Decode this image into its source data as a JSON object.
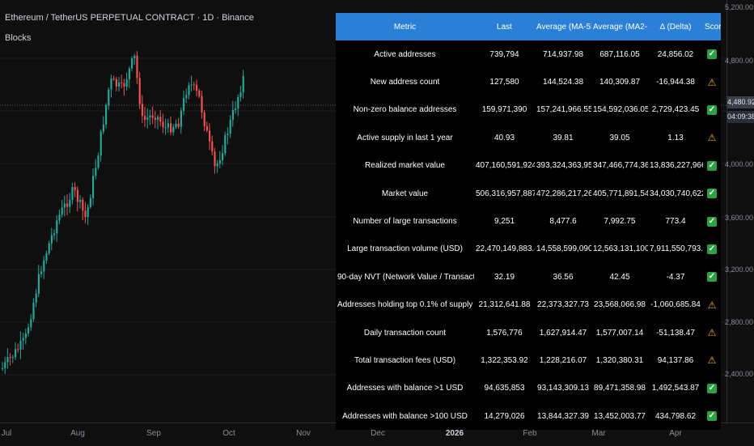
{
  "chart": {
    "title": "Ethereum / TetherUS PERPETUAL CONTRACT · 1D · Binance",
    "indicator": "Blocks",
    "price_labels": [
      "5,200.00",
      "4,800.00",
      "4,400.00",
      "4,000.00",
      "3,600.00",
      "3,200.00",
      "2,800.00",
      "2,400.00"
    ],
    "current_price": "4,480.92",
    "countdown": "04:09:38",
    "time_labels": [
      "Jul",
      "Aug",
      "Sep",
      "Oct",
      "Nov",
      "Dec",
      "2026",
      "Feb",
      "Mar",
      "Apr"
    ],
    "colors": {
      "up": "#26a69a",
      "down": "#ef5350",
      "header": "#2b7fd6"
    }
  },
  "table": {
    "headers": [
      "Metric",
      "Last",
      "Average (MA-55)",
      "Average (MA2-111)",
      "Δ (Delta)",
      "Score"
    ],
    "rows": [
      {
        "metric": "Active addresses",
        "last": "739,794",
        "ma55": "714,937.98",
        "ma111": "687,116.05",
        "delta": "24,856.02",
        "score": "✓",
        "status": "ok"
      },
      {
        "metric": "New address count",
        "last": "127,580",
        "ma55": "144,524.38",
        "ma111": "140,309.87",
        "delta": "-16,944.38",
        "score": "⚠",
        "status": "warn"
      },
      {
        "metric": "Non-zero balance addresses",
        "last": "159,971,390",
        "ma55": "157,241,966.55",
        "ma111": "154,592,036.05",
        "delta": "2,729,423.45",
        "score": "✓",
        "status": "ok"
      },
      {
        "metric": "Active supply in last 1 year",
        "last": "40.93",
        "ma55": "39.81",
        "ma111": "39.05",
        "delta": "1.13",
        "score": "⚠",
        "status": "warn"
      },
      {
        "metric": "Realized market value",
        "last": "407,160,591,924.48",
        "ma55": "393,324,363,958.23",
        "ma111": "347,466,774,365.38",
        "delta": "13,836,227,966.25",
        "score": "✓",
        "status": "ok"
      },
      {
        "metric": "Market value",
        "last": "506,316,957,887.36",
        "ma55": "472,286,217,264.83",
        "ma111": "405,771,891,549.84",
        "delta": "34,030,740,622.53",
        "score": "✓",
        "status": "ok"
      },
      {
        "metric": "Number of large transactions",
        "last": "9,251",
        "ma55": "8,477.6",
        "ma111": "7,992.75",
        "delta": "773.4",
        "score": "✓",
        "status": "ok"
      },
      {
        "metric": "Large transaction volume (USD)",
        "last": "22,470,149,883.85",
        "ma55": "14,558,599,090.63",
        "ma111": "12,563,131,100.91",
        "delta": "7,911,550,793.23",
        "score": "✓",
        "status": "ok"
      },
      {
        "metric": "90-day NVT (Network Value / Transaction Volume)",
        "last": "32.19",
        "ma55": "36.56",
        "ma111": "42.45",
        "delta": "-4.37",
        "score": "✓",
        "status": "ok"
      },
      {
        "metric": "Addresses holding top 0.1% of supply",
        "last": "21,312,641.88",
        "ma55": "22,373,327.73",
        "ma111": "23,568,066.98",
        "delta": "-1,060,685.84",
        "score": "⚠",
        "status": "warn"
      },
      {
        "metric": "Daily transaction count",
        "last": "1,576,776",
        "ma55": "1,627,914.47",
        "ma111": "1,577,007.14",
        "delta": "-51,138.47",
        "score": "⚠",
        "status": "warn"
      },
      {
        "metric": "Total transaction fees (USD)",
        "last": "1,322,353.92",
        "ma55": "1,228,216.07",
        "ma111": "1,320,380.31",
        "delta": "94,137.86",
        "score": "⚠",
        "status": "warn"
      },
      {
        "metric": "Addresses with balance >1 USD",
        "last": "94,635,853",
        "ma55": "93,143,309.13",
        "ma111": "89,471,358.98",
        "delta": "1,492,543.87",
        "score": "✓",
        "status": "ok"
      },
      {
        "metric": "Addresses with balance >100 USD",
        "last": "14,279,026",
        "ma55": "13,844,327.39",
        "ma111": "13,452,003.77",
        "delta": "434,798.62",
        "score": "✓",
        "status": "ok"
      }
    ]
  }
}
